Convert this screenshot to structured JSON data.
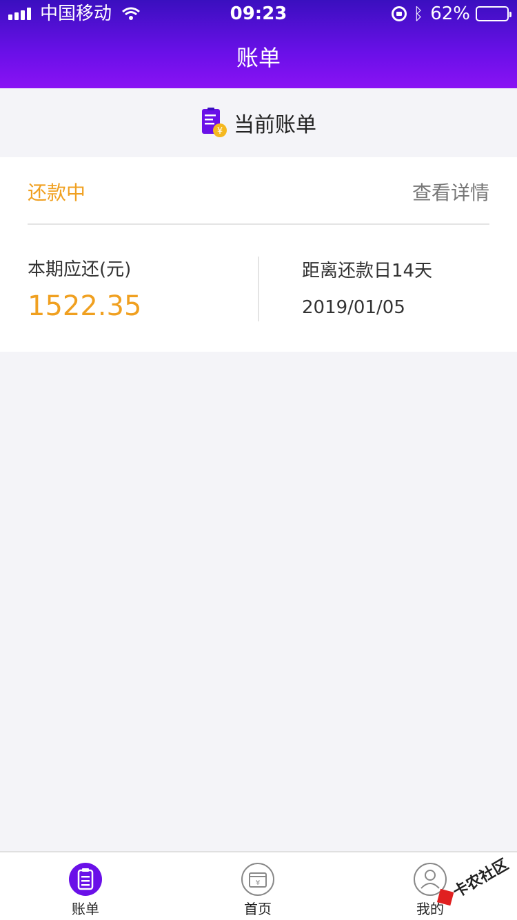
{
  "status_bar": {
    "carrier": "中国移动",
    "time": "09:23",
    "battery": "62%",
    "battery_level": 0.62
  },
  "nav": {
    "title": "账单"
  },
  "section": {
    "title": "当前账单",
    "icon": "bill-yen-icon"
  },
  "bill": {
    "status": "还款中",
    "detail_link": "查看详情",
    "amount_label": "本期应还(元)",
    "amount": "1522.35",
    "due_label": "距离还款日14天",
    "due_date": "2019/01/05"
  },
  "tabs": [
    {
      "label": "账单",
      "icon": "bill-icon",
      "active": true
    },
    {
      "label": "首页",
      "icon": "home-yen-icon",
      "active": false
    },
    {
      "label": "我的",
      "icon": "profile-icon",
      "active": false
    }
  ],
  "watermark": {
    "text": "卡农社区"
  },
  "colors": {
    "header_start": "#3a0fbf",
    "header_end": "#8a12f4",
    "accent_orange": "#f0a020",
    "tab_active": "#6a10e8"
  }
}
